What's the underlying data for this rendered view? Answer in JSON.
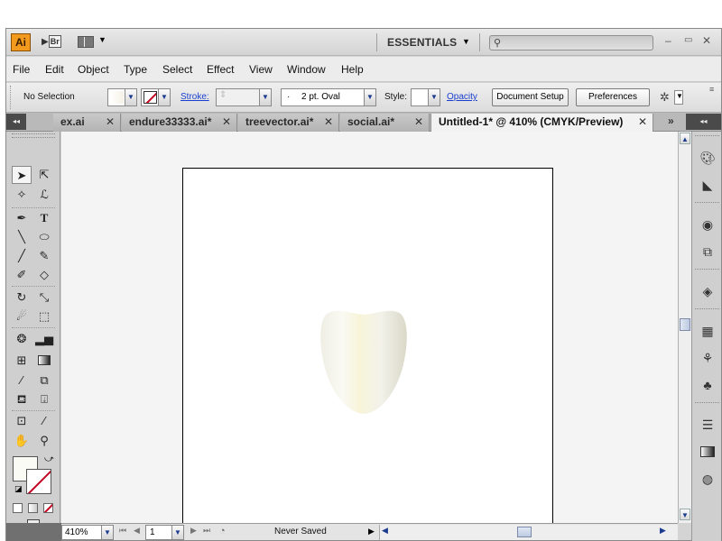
{
  "app": {
    "logo": "Ai",
    "bridge_label": "Br",
    "workspace": "ESSENTIALS",
    "search_placeholder": "",
    "window_controls": {
      "minimize": "–",
      "restore": "▭",
      "close": "✕"
    }
  },
  "menu": [
    "File",
    "Edit",
    "Object",
    "Type",
    "Select",
    "Effect",
    "View",
    "Window",
    "Help"
  ],
  "control_bar": {
    "selection": "No Selection",
    "stroke_label": "Stroke:",
    "brush_value": "2 pt. Oval",
    "brush_bullet": "·",
    "style_label": "Style:",
    "opacity_label": "Opacity",
    "document_setup": "Document Setup",
    "preferences": "Preferences"
  },
  "tabs": [
    {
      "label": "ex.ai",
      "close": "✕"
    },
    {
      "label": "endure33333.ai*",
      "close": "✕"
    },
    {
      "label": "treevector.ai*",
      "close": "✕"
    },
    {
      "label": "social.ai*",
      "close": "✕"
    },
    {
      "label": "Untitled-1* @ 410% (CMYK/Preview)",
      "close": "✕",
      "active": true
    }
  ],
  "tab_overflow": "»",
  "status_bar": {
    "zoom": "410%",
    "page": "1",
    "status": "Never Saved"
  },
  "colors": {
    "ai_orange": "#f19a1d",
    "link_blue": "#1a3fcf",
    "no_stroke_red": "#c4001e"
  },
  "icons": {
    "tools": [
      "selection-tool-icon",
      "direct-selection-tool-icon",
      "magic-wand-icon",
      "lasso-icon",
      "pen-tool-icon",
      "type-tool-icon",
      "line-tool-icon",
      "ellipse-tool-icon",
      "paintbrush-icon",
      "pencil-icon",
      "blob-brush-icon",
      "eraser-icon",
      "rotate-icon",
      "scale-icon",
      "warp-icon",
      "free-transform-icon",
      "symbol-sprayer-icon",
      "column-graph-icon",
      "mesh-icon",
      "gradient-icon",
      "eyedropper-icon",
      "blend-icon",
      "live-paint-bucket-icon",
      "live-paint-selection-icon",
      "artboard-icon",
      "slice-icon",
      "hand-icon",
      "zoom-icon"
    ],
    "dock": [
      "color-icon",
      "color-guide-icon",
      "brushes-icon",
      "symbols-icon",
      "layers-icon",
      "swatches-icon",
      "graphic-styles-icon",
      "club-symbol-icon",
      "stroke-icon",
      "gradient-panel-icon",
      "transparency-icon"
    ]
  }
}
